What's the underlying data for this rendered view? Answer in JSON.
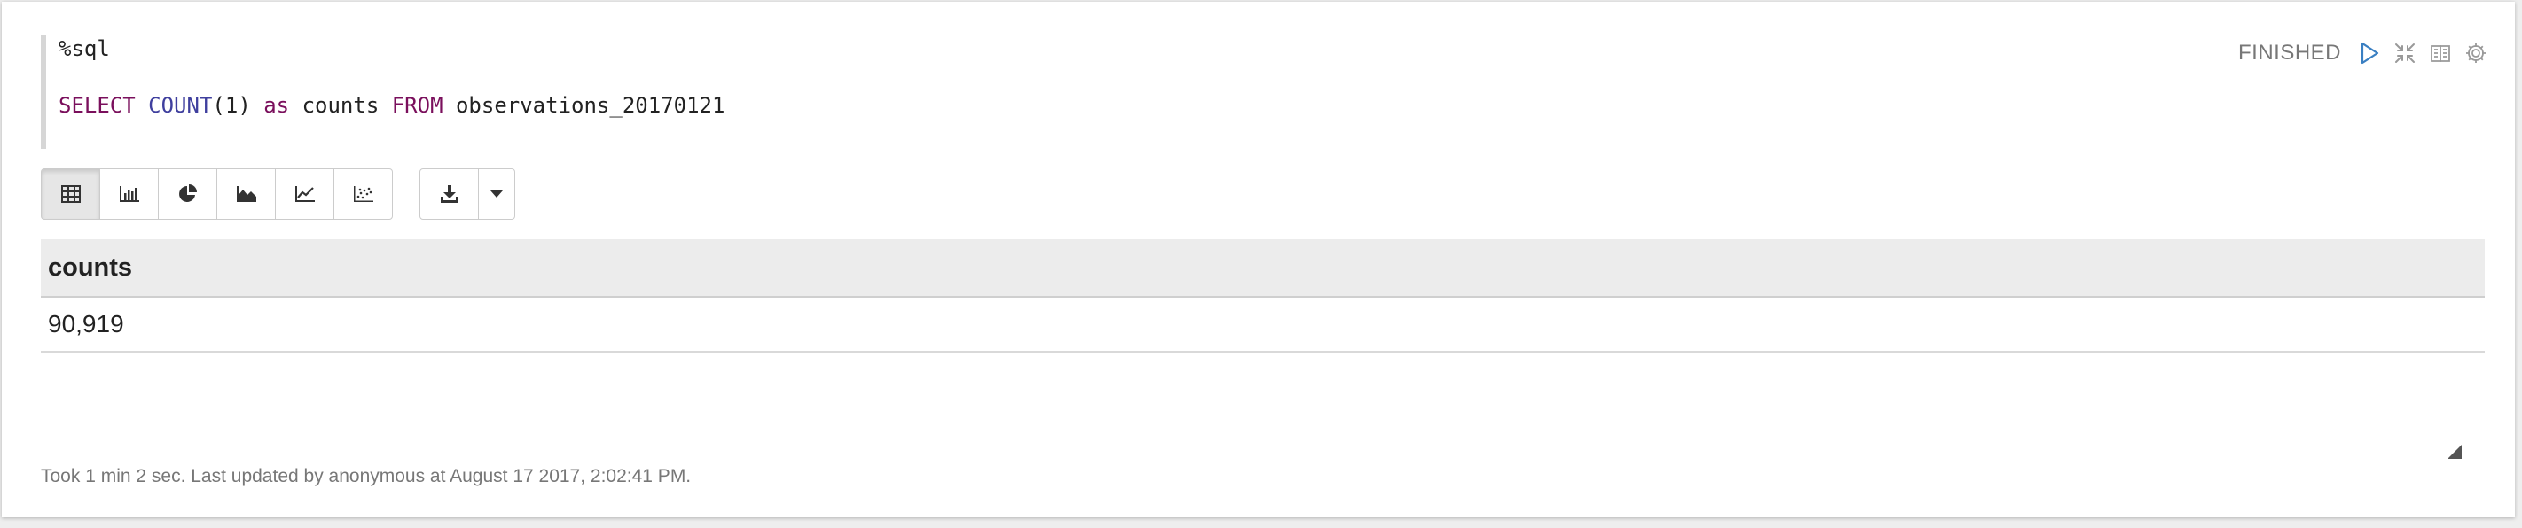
{
  "editor": {
    "line1": "%sql",
    "query": {
      "select_kw": "SELECT",
      "count_fn": "COUNT",
      "open_paren": "(",
      "count_arg": "1",
      "close_paren": ")",
      "as_kw": "as",
      "alias": "counts",
      "from_kw": "FROM",
      "table_name": "observations_20170121"
    }
  },
  "status": {
    "text": "FINISHED",
    "controls": [
      "run-icon",
      "collapse-arrows-icon",
      "book-icon",
      "gear-icon"
    ]
  },
  "toolbar": {
    "views": [
      {
        "icon": "table-icon",
        "active": true
      },
      {
        "icon": "bar-chart-icon",
        "active": false
      },
      {
        "icon": "pie-chart-icon",
        "active": false
      },
      {
        "icon": "area-chart-icon",
        "active": false
      },
      {
        "icon": "line-chart-icon",
        "active": false
      },
      {
        "icon": "scatter-chart-icon",
        "active": false
      }
    ],
    "download_icon": "download-icon",
    "caret_icon": "caret-down-icon"
  },
  "result": {
    "columns": [
      "counts"
    ],
    "rows": [
      [
        "90,919"
      ]
    ]
  },
  "footer": {
    "text": "Took 1 min 2 sec. Last updated by anonymous at August 17 2017, 2:02:41 PM."
  },
  "colors": {
    "keyword": "#7a0f5c",
    "function": "#3f3f9e",
    "header_bg": "#ececec",
    "active_btn_bg": "#e6e6e6"
  }
}
